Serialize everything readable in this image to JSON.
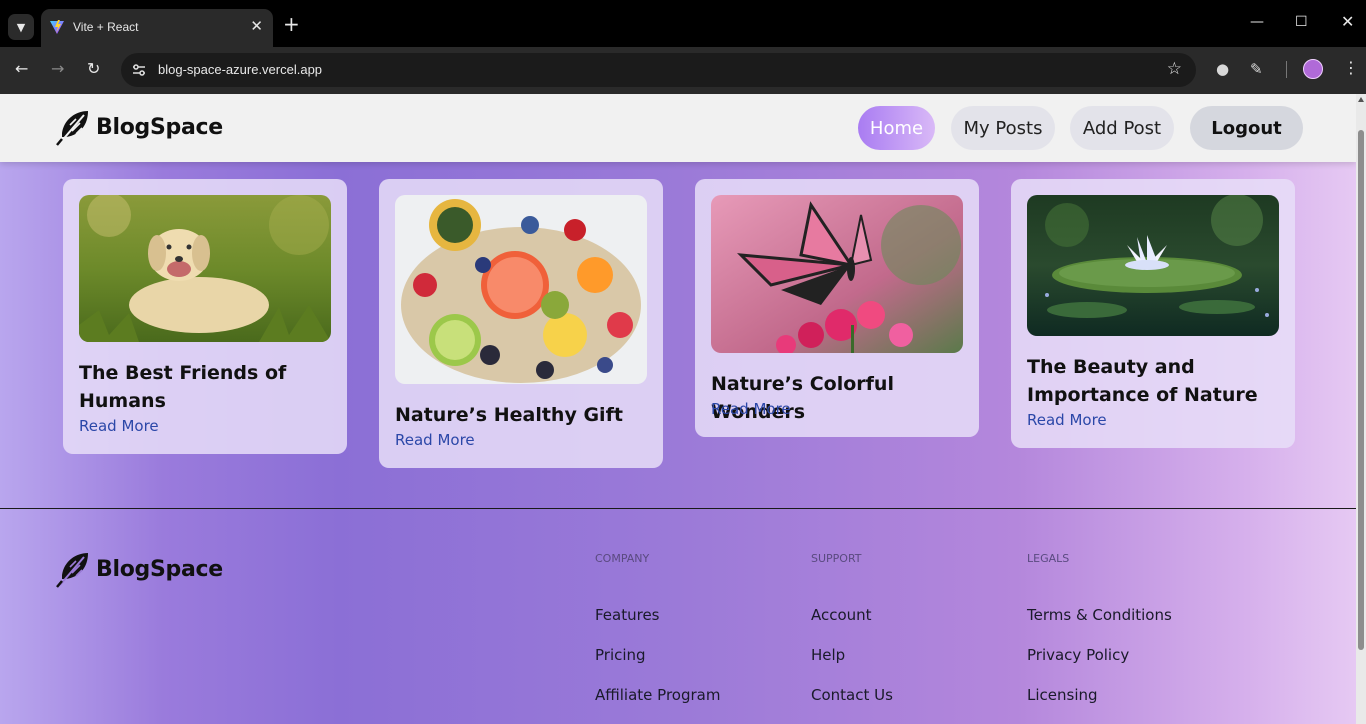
{
  "browser": {
    "tab_title": "Vite + React",
    "url": "blog-space-azure.vercel.app"
  },
  "site": {
    "brand": "BlogSpace",
    "nav": {
      "home": "Home",
      "my_posts": "My Posts",
      "add_post": "Add Post",
      "logout": "Logout"
    }
  },
  "posts": [
    {
      "title": "The Best Friends of Humans",
      "link": "Read More",
      "image": "dog-in-grass"
    },
    {
      "title": "Nature’s Healthy Gift",
      "link": "Read More",
      "image": "fruit-platter"
    },
    {
      "title": "Nature’s Colorful Wonders",
      "link": "Read More",
      "image": "butterfly-on-flowers"
    },
    {
      "title": "The Beauty and Importance of Nature",
      "link": "Read More",
      "image": "water-lily"
    }
  ],
  "footer": {
    "brand": "BlogSpace",
    "columns": [
      {
        "heading": "COMPANY",
        "links": [
          "Features",
          "Pricing",
          "Affiliate Program"
        ]
      },
      {
        "heading": "SUPPORT",
        "links": [
          "Account",
          "Help",
          "Contact Us"
        ]
      },
      {
        "heading": "LEGALS",
        "links": [
          "Terms & Conditions",
          "Privacy Policy",
          "Licensing"
        ]
      }
    ]
  }
}
